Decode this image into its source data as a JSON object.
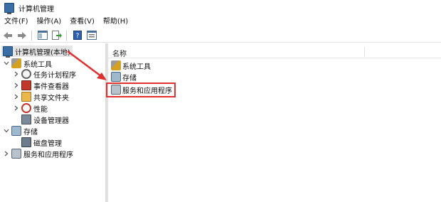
{
  "window": {
    "title": "计算机管理"
  },
  "menubar": {
    "items": [
      "文件(F)",
      "操作(A)",
      "查看(V)",
      "帮助(H)"
    ]
  },
  "toolbar": {
    "buttons": [
      "back-arrow-icon",
      "forward-arrow-icon",
      "show-hide-console-tree-icon",
      "export-list-icon",
      "help-icon",
      "properties-icon"
    ]
  },
  "tree": {
    "root": "计算机管理(本地)",
    "system_tools": "系统工具",
    "task_scheduler": "任务计划程序",
    "event_viewer": "事件查看器",
    "shared_folders": "共享文件夹",
    "performance": "性能",
    "device_manager": "设备管理器",
    "storage": "存储",
    "disk_management": "磁盘管理",
    "services_apps": "服务和应用程序"
  },
  "list": {
    "column_name": "名称",
    "items": [
      "系统工具",
      "存储",
      "服务和应用程序"
    ]
  },
  "annotation": {
    "highlight_color": "#e03030",
    "arrow_color": "#e03030"
  }
}
